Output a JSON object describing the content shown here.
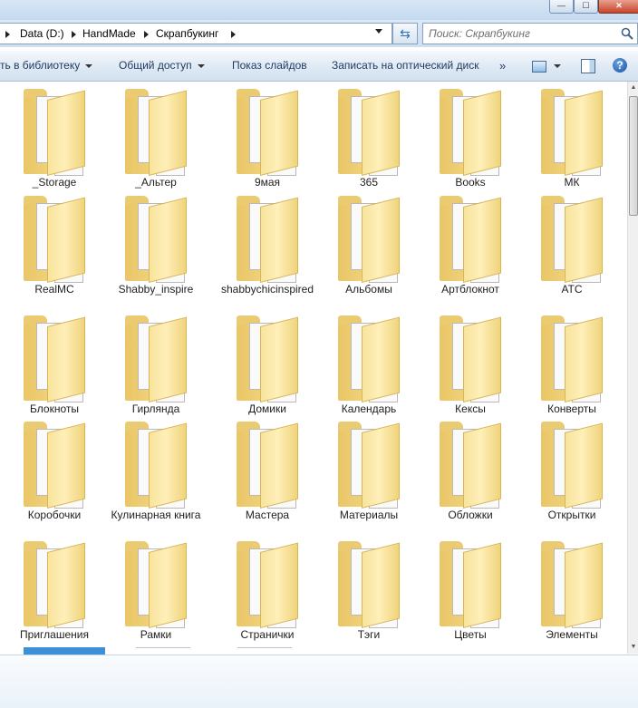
{
  "window": {
    "controls": {
      "minimize": "—",
      "maximize": "☐",
      "close": "✕"
    }
  },
  "address": {
    "crumbs": [
      "Data (D:)",
      "HandMade",
      "Скрапбукинг"
    ],
    "refresh_icon": "refresh-icon"
  },
  "search": {
    "placeholder": "Поиск: Скрапбукинг"
  },
  "toolbar": {
    "add_to_library": "ть в библиотеку",
    "share": "Общий доступ",
    "slideshow": "Показ слайдов",
    "burn": "Записать на оптический диск",
    "more": "»",
    "help": "?"
  },
  "folders": [
    {
      "name": "_Storage"
    },
    {
      "name": "_Альтер"
    },
    {
      "name": "9мая"
    },
    {
      "name": "365"
    },
    {
      "name": "Books"
    },
    {
      "name": "МК"
    },
    {
      "name": "RealMC"
    },
    {
      "name": "Shabby_inspire"
    },
    {
      "name": "shabbychicinspired"
    },
    {
      "name": "Альбомы"
    },
    {
      "name": "Артблокнот"
    },
    {
      "name": "АТС"
    },
    {
      "name": "Блокноты"
    },
    {
      "name": "Гирлянда"
    },
    {
      "name": "Домики"
    },
    {
      "name": "Календарь"
    },
    {
      "name": "Кексы"
    },
    {
      "name": "Конверты"
    },
    {
      "name": "Коробочки"
    },
    {
      "name": "Кулинарная книга"
    },
    {
      "name": "Мастера"
    },
    {
      "name": "Материалы"
    },
    {
      "name": "Обложки"
    },
    {
      "name": "Открытки"
    },
    {
      "name": "Приглашения"
    },
    {
      "name": "Рамки"
    },
    {
      "name": "Странички"
    },
    {
      "name": "Тэги"
    },
    {
      "name": "Цветы"
    },
    {
      "name": "Элементы"
    }
  ],
  "colors": {
    "folder_back": "#e9c565",
    "folder_front": "#ffefb9",
    "toolbar_text": "#1e3a5f",
    "accent": "#2a6fbf"
  }
}
